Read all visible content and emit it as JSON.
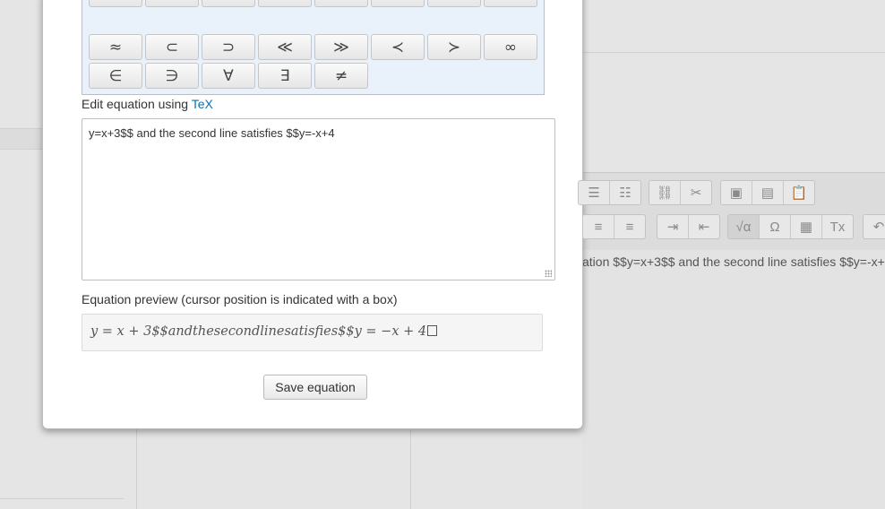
{
  "background": {
    "editor_text": "ation $$y=x+3$$ and the second line satisfies $$y=-x+4",
    "toolbar": {
      "row1": [
        {
          "name": "bullet-list-icon",
          "glyph": "☰"
        },
        {
          "name": "numbered-list-icon",
          "glyph": "☷"
        },
        {
          "name": "link-icon",
          "glyph": "⛓"
        },
        {
          "name": "unlink-icon",
          "glyph": "✂"
        },
        {
          "name": "image-icon",
          "glyph": "▣"
        },
        {
          "name": "media-icon",
          "glyph": "▤"
        },
        {
          "name": "paste-icon",
          "glyph": "📋"
        }
      ],
      "row2": [
        {
          "name": "align-center-icon",
          "glyph": "≡"
        },
        {
          "name": "align-right-icon",
          "glyph": "≡"
        },
        {
          "name": "indent-icon",
          "glyph": "⇥"
        },
        {
          "name": "outdent-icon",
          "glyph": "⇤"
        },
        {
          "name": "equation-icon",
          "glyph": "√α"
        },
        {
          "name": "omega-icon",
          "glyph": "Ω"
        },
        {
          "name": "table-icon",
          "glyph": "▦"
        },
        {
          "name": "clear-format-icon",
          "glyph": "Tx"
        },
        {
          "name": "undo-icon",
          "glyph": "↶"
        }
      ]
    }
  },
  "dialog": {
    "symbols": [
      [
        "⊆",
        "⊇",
        "≤",
        "≥",
        "⪯",
        "⪰",
        "~",
        "≃"
      ],
      [
        "≈",
        "⊂",
        "⊃",
        "≪",
        "≫",
        "≺",
        "≻",
        "∞"
      ],
      [
        "∈",
        "∋",
        "∀",
        "∃",
        "≠"
      ]
    ],
    "edit_label": "Edit equation using ",
    "edit_link": "TeX",
    "tex_value": "y=x+3$$ and the second line satisfies $$y=-x+4",
    "preview_label": "Equation preview (cursor position is indicated with a box)",
    "preview_text": "y = x + 3$$andthesecondlinesatisfies$$y = −x + 4",
    "save_label": "Save equation"
  }
}
